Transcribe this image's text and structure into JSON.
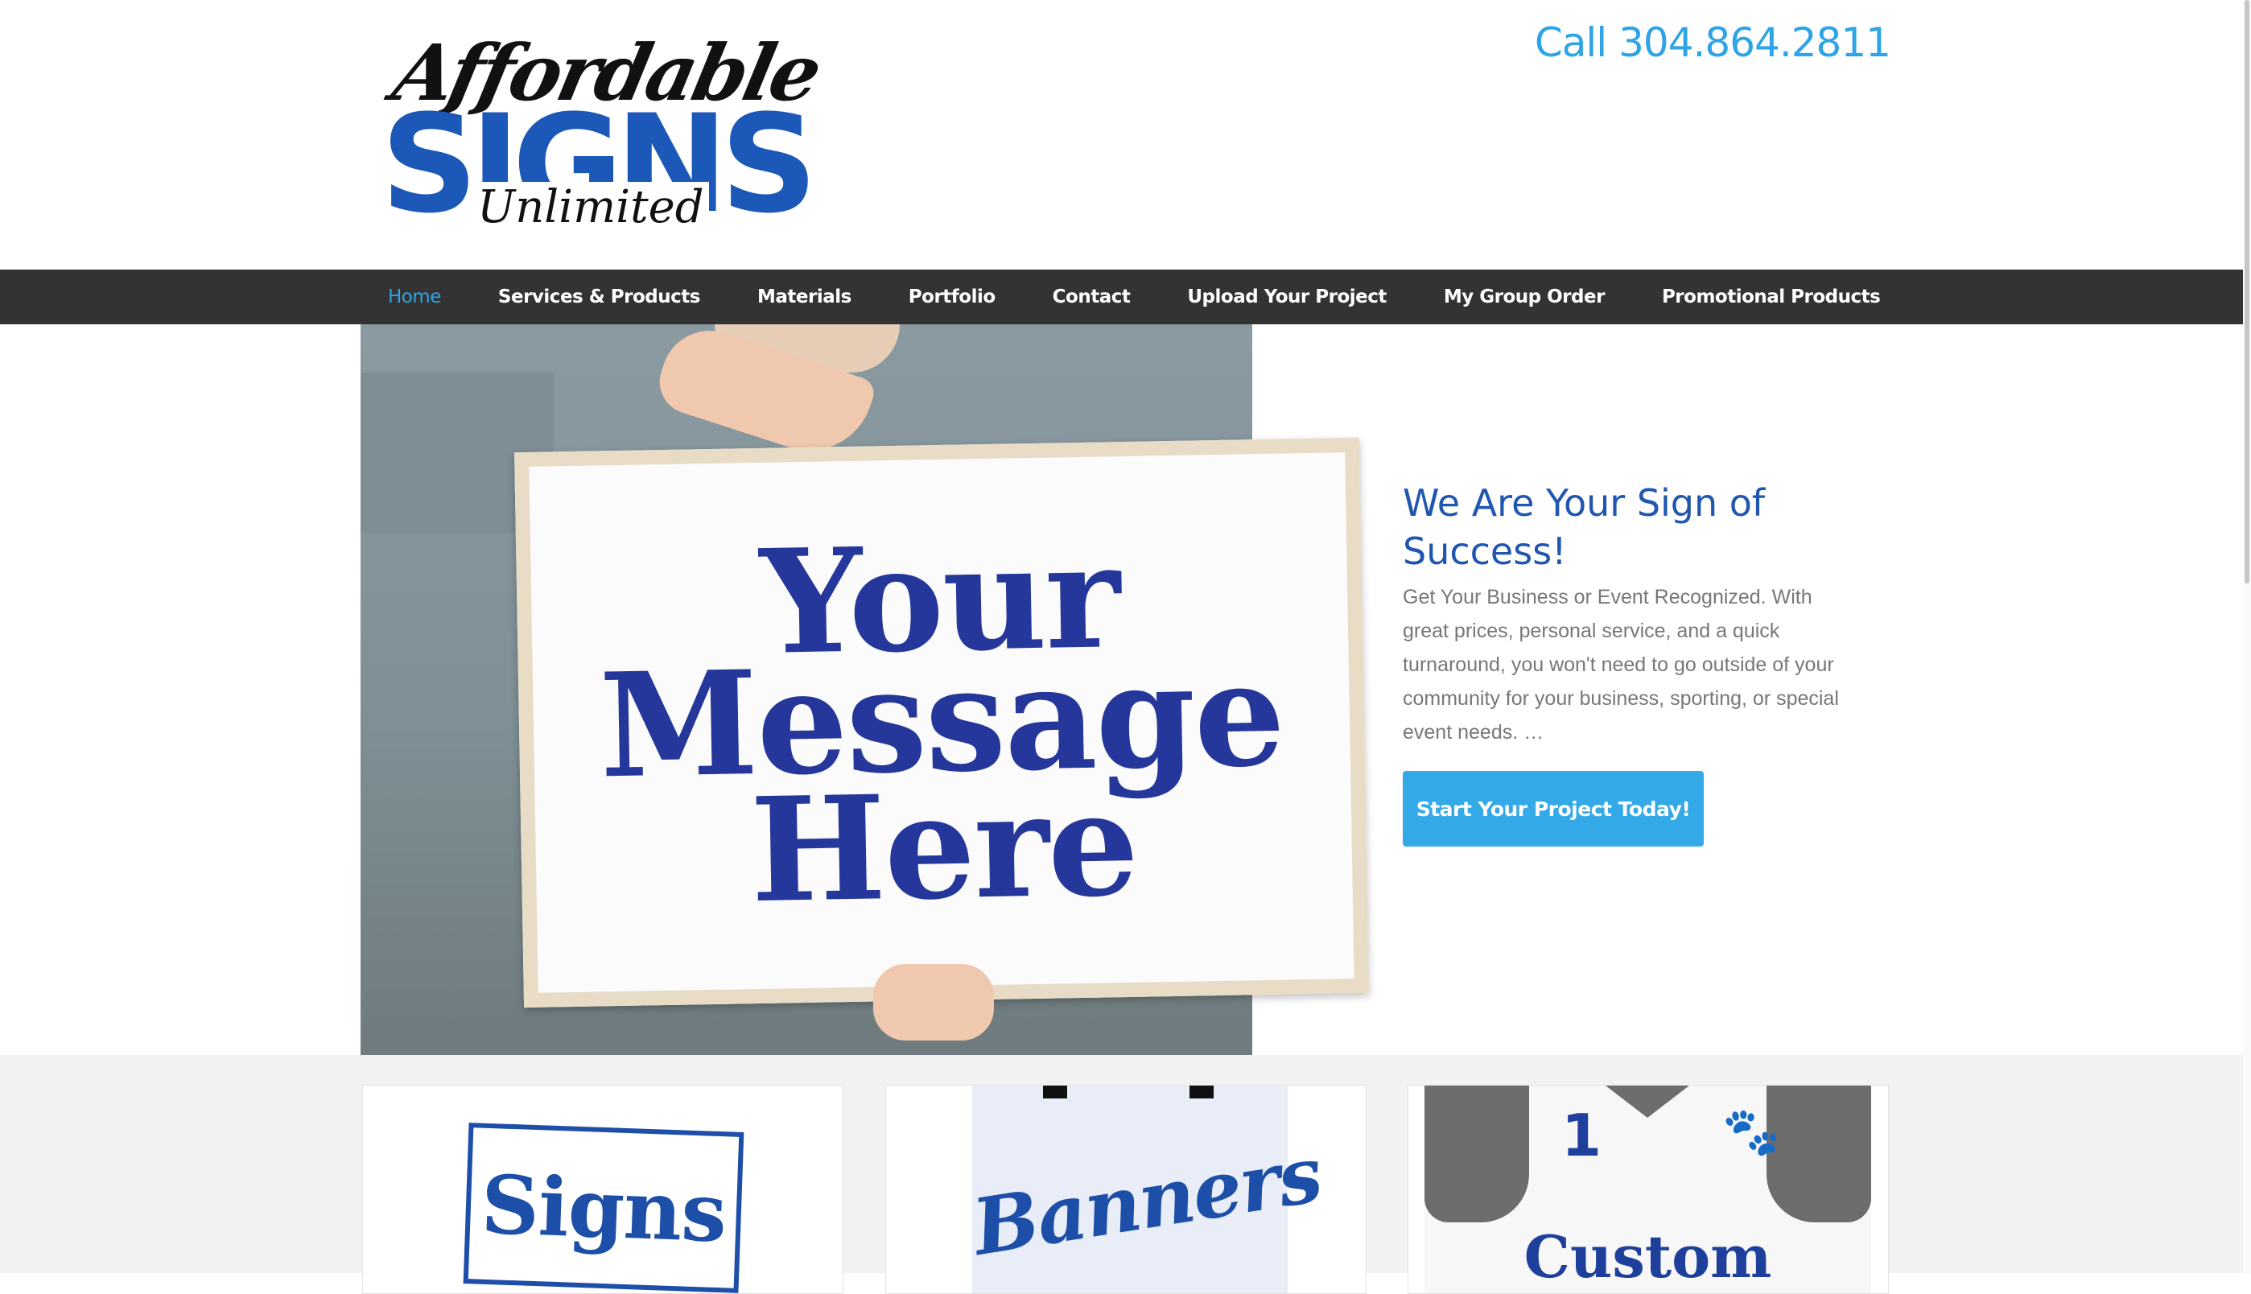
{
  "header": {
    "logo": {
      "script": "Affordable",
      "main": "SIGNS",
      "sub": "Unlimited"
    },
    "phone": "Call 304.864.2811"
  },
  "nav": {
    "items": [
      {
        "label": "Home",
        "active": true
      },
      {
        "label": "Services & Products",
        "active": false
      },
      {
        "label": "Materials",
        "active": false
      },
      {
        "label": "Portfolio",
        "active": false
      },
      {
        "label": "Contact",
        "active": false
      },
      {
        "label": "Upload Your Project",
        "active": false
      },
      {
        "label": "My Group Order",
        "active": false
      },
      {
        "label": "Promotional Products",
        "active": false
      }
    ]
  },
  "hero": {
    "board_lines": [
      "Your",
      "Message",
      "Here"
    ],
    "title": "We Are Your Sign of Success!",
    "body": "Get Your Business or Event Recognized. With great prices, personal service, and a quick turnaround, you won't need to go outside of your community for your business, sporting, or special event needs. …",
    "cta": "Start Your Project Today!"
  },
  "cards": [
    {
      "text": "Signs"
    },
    {
      "text": "Banners"
    },
    {
      "number": "1",
      "text": "Custom"
    }
  ],
  "colors": {
    "accent": "#2ea3e6",
    "brand_blue": "#1f56b0",
    "nav_bg": "#333333",
    "button": "#33a9e8"
  }
}
